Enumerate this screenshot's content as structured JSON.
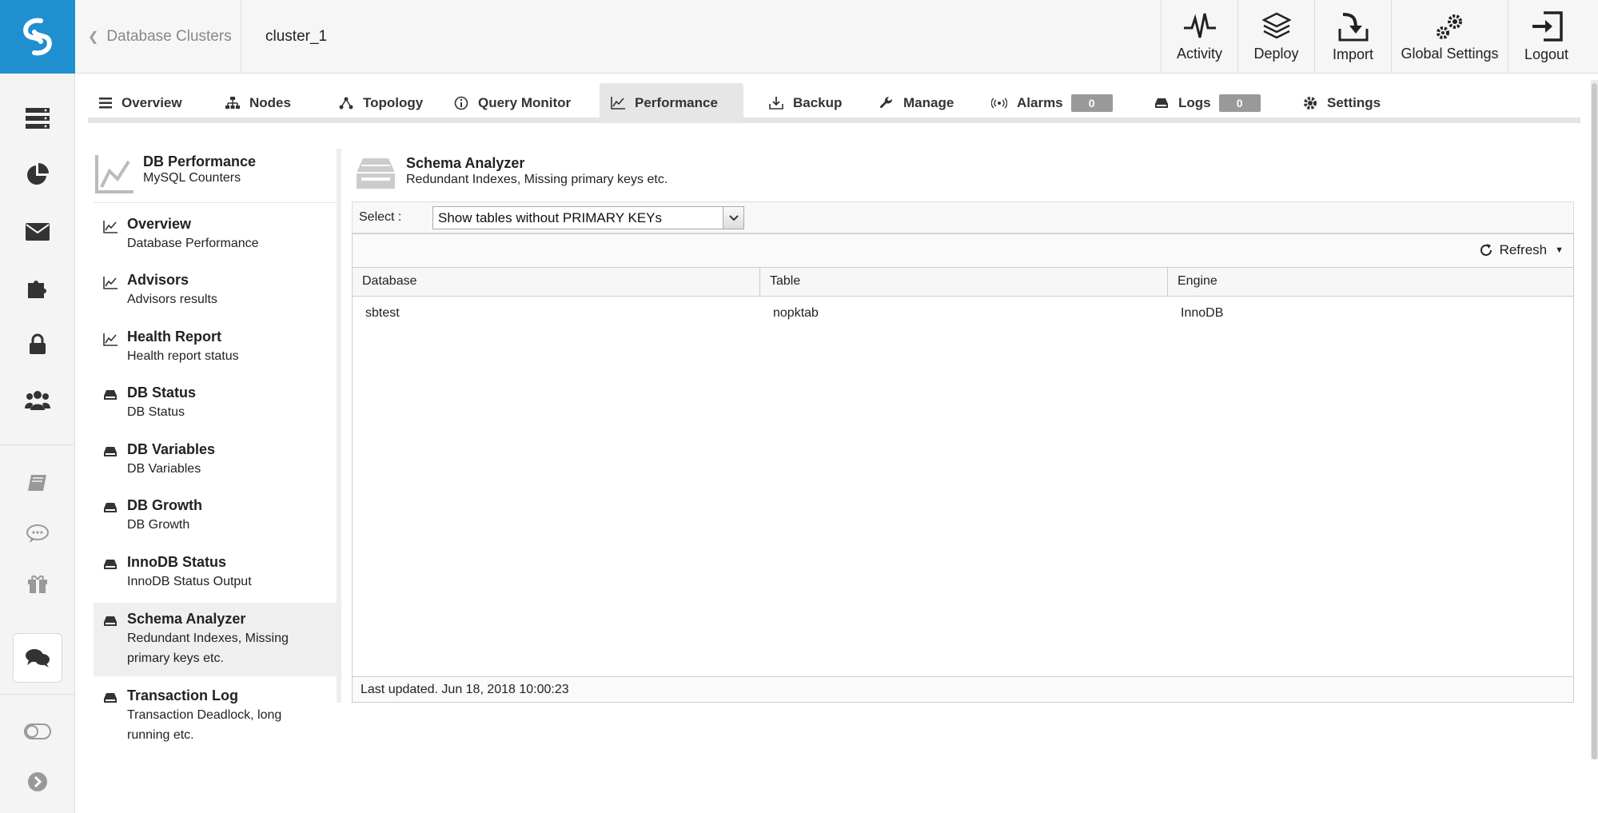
{
  "app": {
    "breadcrumb_back": "Database Clusters",
    "cluster_name": "cluster_1"
  },
  "toolbar": {
    "activity": "Activity",
    "deploy": "Deploy",
    "import": "Import",
    "global_settings": "Global Settings",
    "logout": "Logout"
  },
  "tabs": {
    "overview": "Overview",
    "nodes": "Nodes",
    "topology": "Topology",
    "query_monitor": "Query Monitor",
    "performance": "Performance",
    "backup": "Backup",
    "manage": "Manage",
    "alarms": "Alarms",
    "alarms_count": "0",
    "logs": "Logs",
    "logs_count": "0",
    "settings": "Settings"
  },
  "submenu": {
    "header_title": "DB Performance",
    "header_sub": "MySQL Counters",
    "items": [
      {
        "title": "Overview",
        "sub": "Database Performance"
      },
      {
        "title": "Advisors",
        "sub": "Advisors results"
      },
      {
        "title": "Health Report",
        "sub": "Health report status"
      },
      {
        "title": "DB Status",
        "sub": "DB Status"
      },
      {
        "title": "DB Variables",
        "sub": "DB Variables"
      },
      {
        "title": "DB Growth",
        "sub": "DB Growth"
      },
      {
        "title": "InnoDB Status",
        "sub": "InnoDB Status Output"
      },
      {
        "title": "Schema Analyzer",
        "sub": "Redundant Indexes, Missing primary keys etc."
      },
      {
        "title": "Transaction Log",
        "sub": "Transaction Deadlock, long running etc."
      }
    ]
  },
  "main": {
    "title": "Schema Analyzer",
    "subtitle": "Redundant Indexes, Missing primary keys etc.",
    "select_label": "Select :",
    "select_value": "Show tables without PRIMARY KEYs",
    "refresh_label": "Refresh",
    "columns": [
      "Database",
      "Table",
      "Engine"
    ],
    "rows": [
      [
        "sbtest",
        "nopktab",
        "InnoDB"
      ]
    ],
    "last_updated": "Last updated. Jun 18, 2018 10:00:23"
  },
  "colors": {
    "brand": "#1f8fcf",
    "badge": "#999999",
    "active_tab": "#e6e6e6"
  }
}
